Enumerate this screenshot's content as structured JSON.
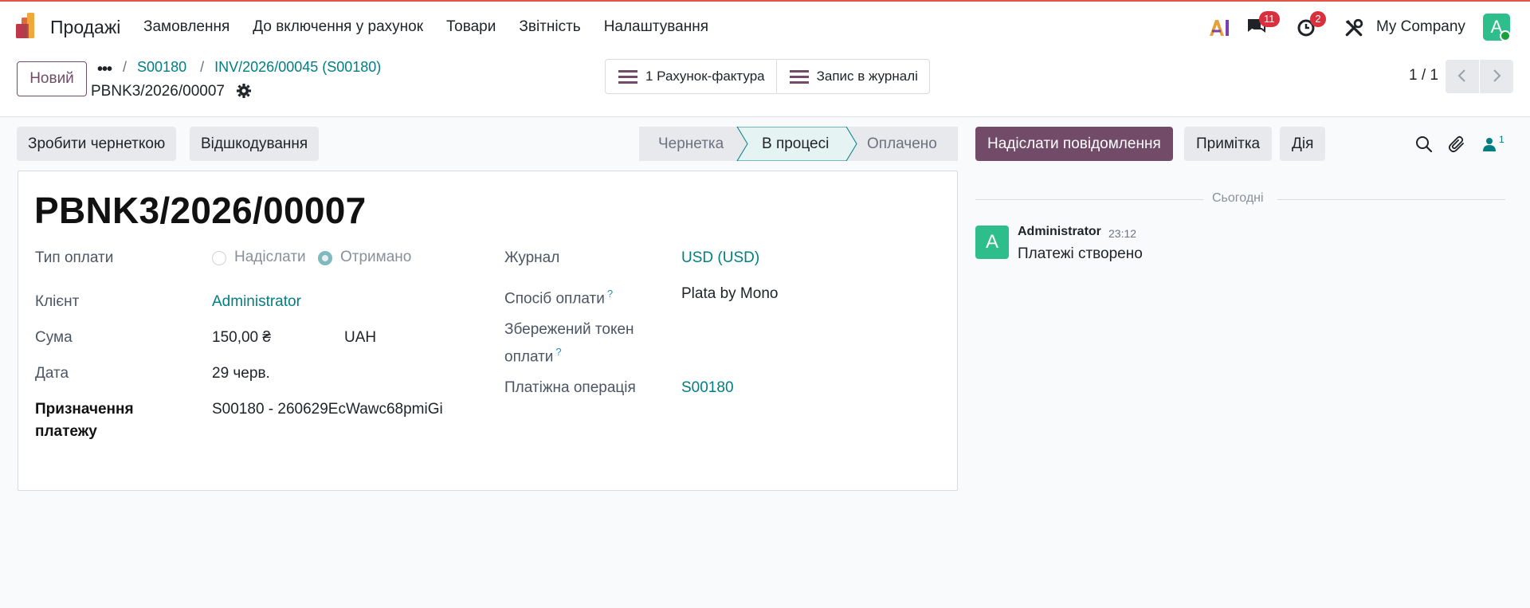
{
  "app": {
    "name": "Продажі",
    "menu": [
      "Замовлення",
      "До включення у рахунок",
      "Товари",
      "Звітність",
      "Налаштування"
    ]
  },
  "systray": {
    "messages_count": "11",
    "activities_count": "2",
    "company": "My Company",
    "user_initial": "A",
    "ai_icon": "ai-icon",
    "debug_icon": "tools-icon"
  },
  "control": {
    "new_label": "Новий",
    "more_label": "...",
    "breadcrumbs": [
      "S00180",
      "INV/2026/00045 (S00180)"
    ],
    "record_name": "PBNK3/2026/00007",
    "smart_buttons": [
      "1 Рахунок-фактура",
      "Запис в журналі"
    ],
    "pager": "1 / 1"
  },
  "actions": {
    "draft": "Зробити чернеткою",
    "refund": "Відшкодування"
  },
  "stages": {
    "items": [
      "Чернетка",
      "В процесі",
      "Оплачено"
    ],
    "active": "В процесі"
  },
  "form": {
    "title": "PBNK3/2026/00007",
    "payment_type_label": "Тип оплати",
    "payment_type_options": [
      "Надіслати",
      "Отримано"
    ],
    "payment_type_selected": "Отримано",
    "customer_label": "Клієнт",
    "customer": "Administrator",
    "amount_label": "Сума",
    "amount": "150,00 ₴",
    "currency": "UAH",
    "date_label": "Дата",
    "date": "29 черв.",
    "memo_label_1": "Призначення",
    "memo_label_2": "платежу",
    "memo": "S00180 - 260629EcWawc68pmiGi",
    "journal_label": "Журнал",
    "journal": "USD (USD)",
    "method_label": "Спосіб оплати",
    "method": "Plata by Mono",
    "token_label_1": "Збережений токен",
    "token_label_2": "оплати",
    "transaction_label": "Платіжна операція",
    "transaction": "S00180",
    "help_mark": "?"
  },
  "chatter": {
    "send_message": "Надіслати повідомлення",
    "log_note": "Примітка",
    "activity": "Дія",
    "followers_count": "1",
    "date_separator": "Сьогодні",
    "message": {
      "author_initial": "A",
      "author": "Administrator",
      "time": "23:12",
      "body": "Платежі створено"
    }
  },
  "colors": {
    "brand": "#714b67",
    "link": "#017e84",
    "avatar": "#2ebe8c",
    "badge": "#d9303e",
    "top_border": "#e0574a"
  }
}
